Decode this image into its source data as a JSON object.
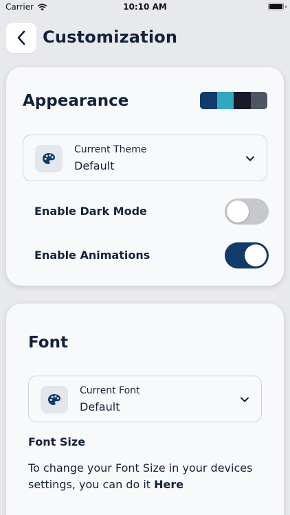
{
  "status_bar": {
    "carrier": "Carrier",
    "time": "10:10 AM"
  },
  "header": {
    "title": "Customization",
    "back_icon": "chevron-left-icon"
  },
  "appearance": {
    "title": "Appearance",
    "palette": [
      "#123a6b",
      "#33a6c1",
      "#18192a",
      "#4e5563"
    ],
    "theme_dropdown": {
      "icon": "palette-icon",
      "label": "Current Theme",
      "value": "Default"
    },
    "dark_mode": {
      "label": "Enable Dark Mode",
      "enabled": false
    },
    "animations": {
      "label": "Enable Animations",
      "enabled": true
    }
  },
  "font": {
    "title": "Font",
    "font_dropdown": {
      "icon": "palette-icon",
      "label": "Current Font",
      "value": "Default"
    },
    "font_size_heading": "Font Size",
    "font_size_desc": "To change your Font Size in your devices settings, you can do it",
    "font_size_link": "Here"
  },
  "colors": {
    "accent": "#123a6b",
    "toggle_off": "#c6c8cc",
    "background": "#e8e9ed",
    "card": "#f8f9fb"
  }
}
